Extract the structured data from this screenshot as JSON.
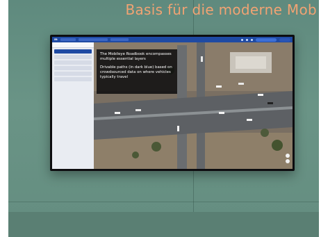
{
  "wall_sign": {
    "text": "Basis für die moderne Mob"
  },
  "screen": {
    "overlay": {
      "lines": [
        "The Mobileye Roadbook encompasses",
        "multiple essential layers",
        "",
        "Drivable paths (in dark blue) based on",
        "crowdsourced data on where vehicles",
        "typically travel"
      ]
    }
  },
  "colors": {
    "wall": "#648d80",
    "sign_text": "#f1a373",
    "topbar": "#1f4aa3",
    "overlay_bg": "#0a0a0c"
  }
}
